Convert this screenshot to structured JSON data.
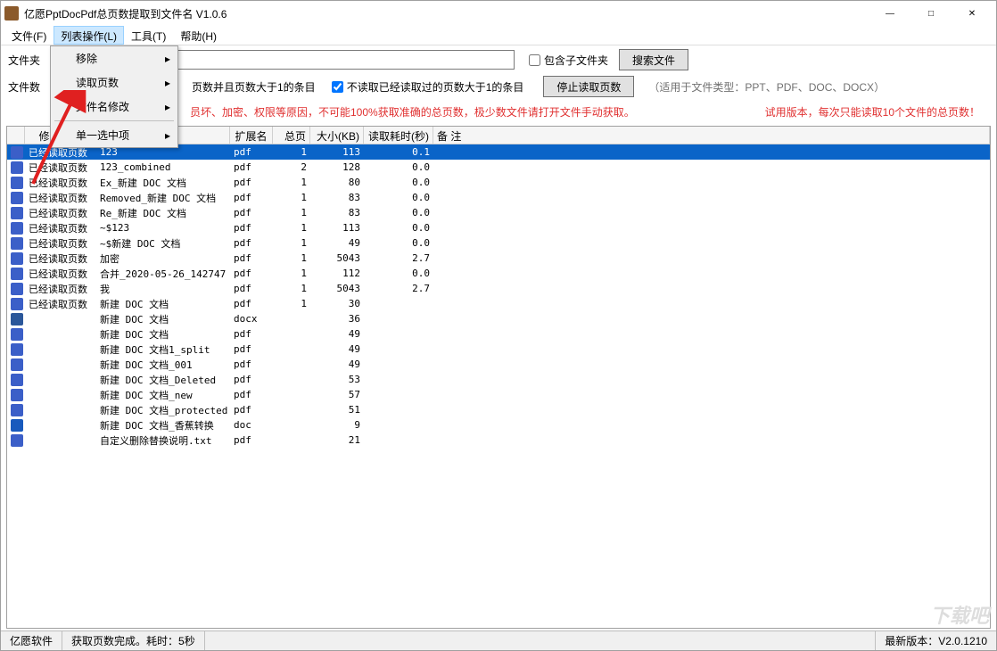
{
  "window": {
    "title": "亿愿PptDocPdf总页数提取到文件名 V1.0.6",
    "min": "—",
    "max": "□",
    "close": "✕"
  },
  "menubar": {
    "file": "文件(F)",
    "list": "列表操作(L)",
    "tools": "工具(T)",
    "help": "帮助(H)"
  },
  "dropdown": {
    "items": [
      "移除",
      "读取页数",
      "文件名修改",
      "单一选中项"
    ],
    "arrow": "▸"
  },
  "row1": {
    "label": "文件夹",
    "folder_value": "",
    "subfolder_label": "包含子文件夹",
    "search_btn": "搜索文件"
  },
  "row2": {
    "label": "文件数",
    "chk1_label": "页数并且页数大于1的条目",
    "chk2_label": "不读取已经读取过的页数大于1的条目",
    "stop_btn": "停止读取页数",
    "hint": "（适用于文件类型：PPT、PDF、DOC、DOCX）"
  },
  "row3": {
    "warn": "员坏、加密、权限等原因，不可能100%获取准确的总页数，极少数文件请打开文件手动获取。",
    "trial": "试用版本，每次只能读取10个文件的总页数！"
  },
  "columns": {
    "status": "修改状态",
    "name": "",
    "ext": "扩展名",
    "pages": "总页数",
    "size": "大小(KB)",
    "time": "读取耗时(秒)",
    "note": "备      注"
  },
  "rows": [
    {
      "sel": true,
      "icon": "pdf",
      "status": "已经读取页数",
      "name": "123",
      "ext": "pdf",
      "pages": "1",
      "size": "113",
      "time": "0.1"
    },
    {
      "sel": false,
      "icon": "pdf",
      "status": "已经读取页数",
      "name": "123_combined",
      "ext": "pdf",
      "pages": "2",
      "size": "128",
      "time": "0.0"
    },
    {
      "sel": false,
      "icon": "pdf",
      "status": "已经读取页数",
      "name": "Ex_新建 DOC 文档",
      "ext": "pdf",
      "pages": "1",
      "size": "80",
      "time": "0.0"
    },
    {
      "sel": false,
      "icon": "pdf",
      "status": "已经读取页数",
      "name": "Removed_新建 DOC 文档",
      "ext": "pdf",
      "pages": "1",
      "size": "83",
      "time": "0.0"
    },
    {
      "sel": false,
      "icon": "pdf",
      "status": "已经读取页数",
      "name": "Re_新建 DOC 文档",
      "ext": "pdf",
      "pages": "1",
      "size": "83",
      "time": "0.0"
    },
    {
      "sel": false,
      "icon": "pdf",
      "status": "已经读取页数",
      "name": "~$123",
      "ext": "pdf",
      "pages": "1",
      "size": "113",
      "time": "0.0"
    },
    {
      "sel": false,
      "icon": "pdf",
      "status": "已经读取页数",
      "name": "~$新建 DOC 文档",
      "ext": "pdf",
      "pages": "1",
      "size": "49",
      "time": "0.0"
    },
    {
      "sel": false,
      "icon": "pdf",
      "status": "已经读取页数",
      "name": "加密",
      "ext": "pdf",
      "pages": "1",
      "size": "5043",
      "time": "2.7"
    },
    {
      "sel": false,
      "icon": "pdf",
      "status": "已经读取页数",
      "name": "合并_2020-05-26_142747",
      "ext": "pdf",
      "pages": "1",
      "size": "112",
      "time": "0.0"
    },
    {
      "sel": false,
      "icon": "pdf",
      "status": "已经读取页数",
      "name": "我",
      "ext": "pdf",
      "pages": "1",
      "size": "5043",
      "time": "2.7"
    },
    {
      "sel": false,
      "icon": "pdf",
      "status": "已经读取页数",
      "name": "新建 DOC 文档",
      "ext": "pdf",
      "pages": "1",
      "size": "30",
      "time": ""
    },
    {
      "sel": false,
      "icon": "docx",
      "status": "",
      "name": "新建 DOC 文档",
      "ext": "docx",
      "pages": "",
      "size": "36",
      "time": ""
    },
    {
      "sel": false,
      "icon": "pdf",
      "status": "",
      "name": "新建 DOC 文档",
      "ext": "pdf",
      "pages": "",
      "size": "49",
      "time": ""
    },
    {
      "sel": false,
      "icon": "pdf",
      "status": "",
      "name": "新建 DOC 文档1_split",
      "ext": "pdf",
      "pages": "",
      "size": "49",
      "time": ""
    },
    {
      "sel": false,
      "icon": "pdf",
      "status": "",
      "name": "新建 DOC 文档_001",
      "ext": "pdf",
      "pages": "",
      "size": "49",
      "time": ""
    },
    {
      "sel": false,
      "icon": "pdf",
      "status": "",
      "name": "新建 DOC 文档_Deleted",
      "ext": "pdf",
      "pages": "",
      "size": "53",
      "time": ""
    },
    {
      "sel": false,
      "icon": "pdf",
      "status": "",
      "name": "新建 DOC 文档_new",
      "ext": "pdf",
      "pages": "",
      "size": "57",
      "time": ""
    },
    {
      "sel": false,
      "icon": "pdf",
      "status": "",
      "name": "新建 DOC 文档_protected",
      "ext": "pdf",
      "pages": "",
      "size": "51",
      "time": ""
    },
    {
      "sel": false,
      "icon": "doc",
      "status": "",
      "name": "新建 DOC 文档_香蕉转换",
      "ext": "doc",
      "pages": "",
      "size": "9",
      "time": ""
    },
    {
      "sel": false,
      "icon": "pdf",
      "status": "",
      "name": "自定义删除替换说明.txt",
      "ext": "pdf",
      "pages": "",
      "size": "21",
      "time": ""
    }
  ],
  "statusbar": {
    "left": "亿愿软件",
    "mid": "获取页数完成。耗时：5秒",
    "right": "最新版本：V2.0.1210"
  },
  "watermark": "下载吧"
}
